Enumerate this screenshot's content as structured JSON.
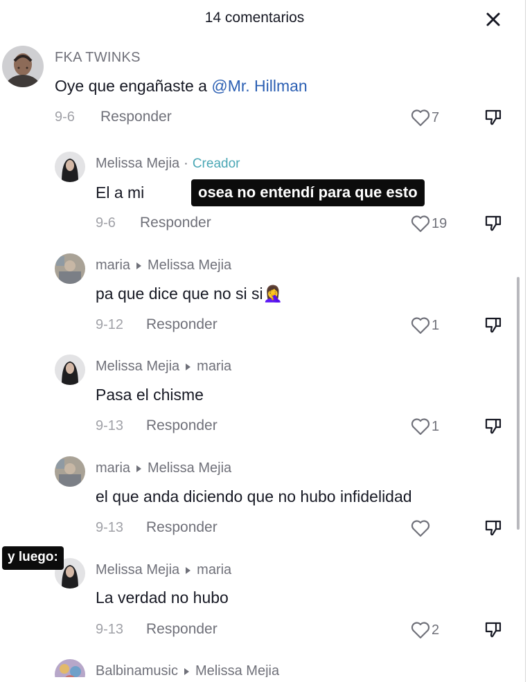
{
  "header": {
    "title": "14 comentarios"
  },
  "icons": {
    "close": "close-icon",
    "like": "heart-outline-icon",
    "dislike": "thumb-down-icon"
  },
  "comments": [
    {
      "user": "FKA TWINKS",
      "text": "Oye que engañaste a ",
      "mention": "@Mr. Hillman",
      "date": "9-6",
      "reply": "Responder",
      "likes": "7"
    },
    {
      "user": "Melissa Mejia",
      "creator_sep": "·",
      "creator": "Creador",
      "text": "El a mi",
      "date": "9-6",
      "reply": "Responder",
      "likes": "19"
    },
    {
      "user": "maria",
      "reply_to": "Melissa Mejia",
      "text": "pa que dice que no si si",
      "emoji": "🤦‍♀️",
      "date": "9-12",
      "reply": "Responder",
      "likes": "1"
    },
    {
      "user": "Melissa Mejia",
      "reply_to": "maria",
      "text": "Pasa el chisme",
      "date": "9-13",
      "reply": "Responder",
      "likes": "1"
    },
    {
      "user": "maria",
      "reply_to": "Melissa Mejia",
      "text": "el que anda diciendo que no hubo infidelidad",
      "date": "9-13",
      "reply": "Responder",
      "likes": ""
    },
    {
      "user": "Melissa Mejia",
      "reply_to": "maria",
      "text": "La verdad no hubo",
      "date": "9-13",
      "reply": "Responder",
      "likes": "2"
    },
    {
      "user": "Balbinamusic",
      "reply_to": "Melissa Mejia"
    }
  ],
  "overlays": {
    "caption": "osea no entendí para que esto",
    "later": "y luego:"
  },
  "colors": {
    "mention": "#2b5fb3",
    "creator": "#4aa7b5",
    "meta": "#6f7079"
  }
}
